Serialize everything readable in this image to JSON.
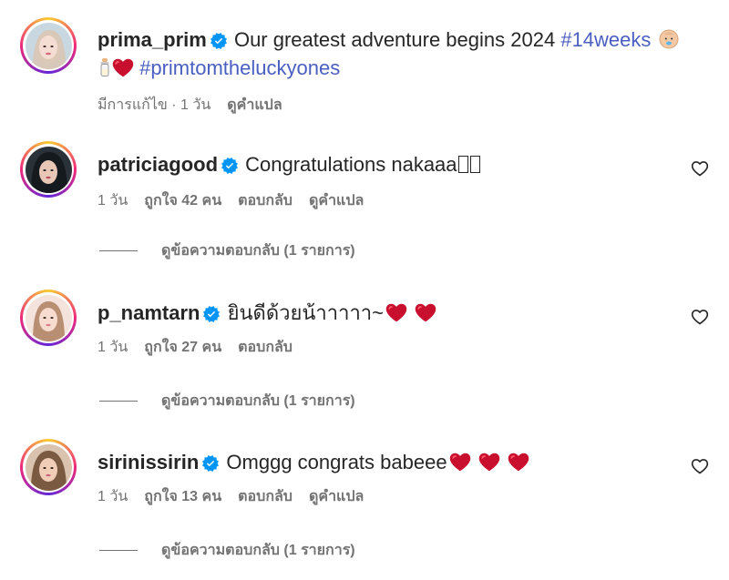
{
  "post": {
    "username": "prima_prim",
    "caption": "Our greatest adventure begins 2024",
    "hashtag1": "#14weeks",
    "hashtag2": "#primtomtheluckyones",
    "edited": "มีการแก้ไข · 1 วัน",
    "translate": "ดูคำแปล"
  },
  "comments": [
    {
      "username": "patriciagood",
      "text": "Congratulations nakaaa",
      "time": "1 วัน",
      "likes": "ถูกใจ 42 คน",
      "reply": "ตอบกลับ",
      "translate": "ดูคำแปล",
      "view_replies": "ดูข้อความตอบกลับ (1 รายการ)"
    },
    {
      "username": "p_namtarn",
      "text": "ยินดีด้วยน้าาาาา~",
      "time": "1 วัน",
      "likes": "ถูกใจ 27 คน",
      "reply": "ตอบกลับ",
      "view_replies": "ดูข้อความตอบกลับ (1 รายการ)"
    },
    {
      "username": "sirinissirin",
      "text": "Omggg congrats babeee",
      "time": "1 วัน",
      "likes": "ถูกใจ 13 คน",
      "reply": "ตอบกลับ",
      "translate": "ดูคำแปล",
      "view_replies": "ดูข้อความตอบกลับ (1 รายการ)"
    }
  ],
  "colors": {
    "verified": "#0095f6",
    "hashtag": "#4a5fc1",
    "muted": "#737373",
    "heart_emoji": "#e0245e"
  },
  "icons": [
    "verified-badge-icon",
    "heart-outline-icon",
    "baby-emoji-icon",
    "baby-bottle-emoji-icon",
    "heart-emoji-icon"
  ]
}
